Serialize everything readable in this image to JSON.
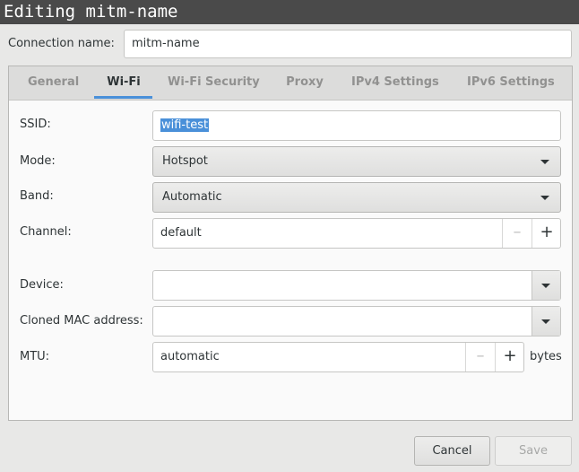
{
  "window": {
    "title": "Editing mitm-name"
  },
  "connection": {
    "label": "Connection name:",
    "value": "mitm-name"
  },
  "tabs": [
    {
      "label": "General"
    },
    {
      "label": "Wi-Fi"
    },
    {
      "label": "Wi-Fi Security"
    },
    {
      "label": "Proxy"
    },
    {
      "label": "IPv4 Settings"
    },
    {
      "label": "IPv6 Settings"
    }
  ],
  "active_tab": "Wi-Fi",
  "wifi": {
    "ssid_label": "SSID:",
    "ssid_value": "wifi-test",
    "mode_label": "Mode:",
    "mode_value": "Hotspot",
    "band_label": "Band:",
    "band_value": "Automatic",
    "channel_label": "Channel:",
    "channel_value": "default",
    "device_label": "Device:",
    "device_value": "",
    "cloned_mac_label": "Cloned MAC address:",
    "cloned_mac_value": "",
    "mtu_label": "MTU:",
    "mtu_value": "automatic",
    "mtu_unit": "bytes",
    "minus_glyph": "–",
    "plus_glyph": "+"
  },
  "buttons": {
    "cancel": "Cancel",
    "save": "Save"
  },
  "colors": {
    "accent": "#4a90d9",
    "titlebar": "#4a4a4a"
  }
}
